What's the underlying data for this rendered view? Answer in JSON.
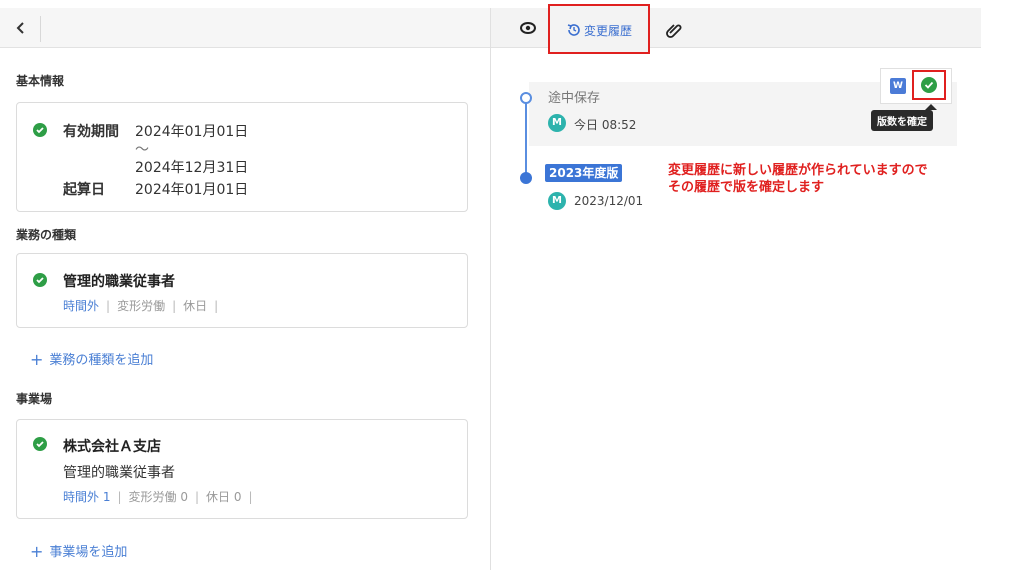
{
  "header": {
    "back_icon": "chevron-left-icon",
    "history_tab_label": "変更履歴"
  },
  "basic_info": {
    "section_label": "基本情報",
    "validity_label": "有効期間",
    "validity_start": "2024年01月01日",
    "validity_tilde": "～",
    "validity_end": "2024年12月31日",
    "base_date_label": "起算日",
    "base_date_value": "2024年01月01日"
  },
  "business_types": {
    "section_label": "業務の種類",
    "card_title": "管理的職業従事者",
    "tags": [
      "時間外",
      "変形労働",
      "休日"
    ],
    "add_label": "業務の種類を追加"
  },
  "workplaces": {
    "section_label": "事業場",
    "card_title": "株式会社Ａ支店",
    "card_subtitle": "管理的職業従事者",
    "tags": [
      "時間外 1",
      "変形労働 0",
      "休日 0"
    ],
    "add_label": "事業場を追加"
  },
  "history": {
    "draft_label": "途中保存",
    "draft_avatar": "M",
    "draft_time": "今日 08:52",
    "version_badge": "2023年度版",
    "version_avatar": "M",
    "version_date": "2023/12/01",
    "word_button_label": "W",
    "confirm_tooltip": "版数を確定"
  },
  "annotation": {
    "line1": "変更履歴に新しい履歴が作られていますので",
    "line2": "その履歴で版を確定します"
  },
  "colors": {
    "accent_blue": "#3b75d6",
    "check_green": "#2e9e46",
    "highlight_red": "#e0201f"
  }
}
